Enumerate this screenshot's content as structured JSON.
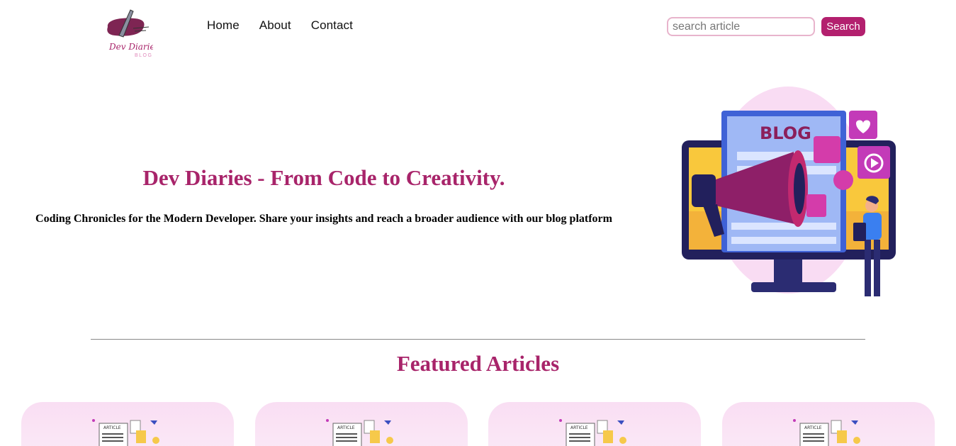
{
  "header": {
    "logo_text": "Dev Diaries",
    "logo_subtext": "BLOG",
    "nav": [
      {
        "label": "Home"
      },
      {
        "label": "About"
      },
      {
        "label": "Contact"
      }
    ],
    "search": {
      "placeholder": "search article",
      "button_label": "Search"
    }
  },
  "hero": {
    "title": "Dev Diaries - From Code to Creativity.",
    "subtitle": "Coding Chronicles for the Modern Developer. Share your insights and reach a broader audience with our blog platform",
    "illustration_label": "BLOG"
  },
  "featured": {
    "title": "Featured Articles",
    "cards": [
      {
        "label": "ARTICLE"
      },
      {
        "label": "ARTICLE"
      },
      {
        "label": "ARTICLE"
      },
      {
        "label": "ARTICLE"
      }
    ]
  },
  "colors": {
    "accent": "#a8246a",
    "button": "#b3206e",
    "card_bg": "#f9def3"
  }
}
